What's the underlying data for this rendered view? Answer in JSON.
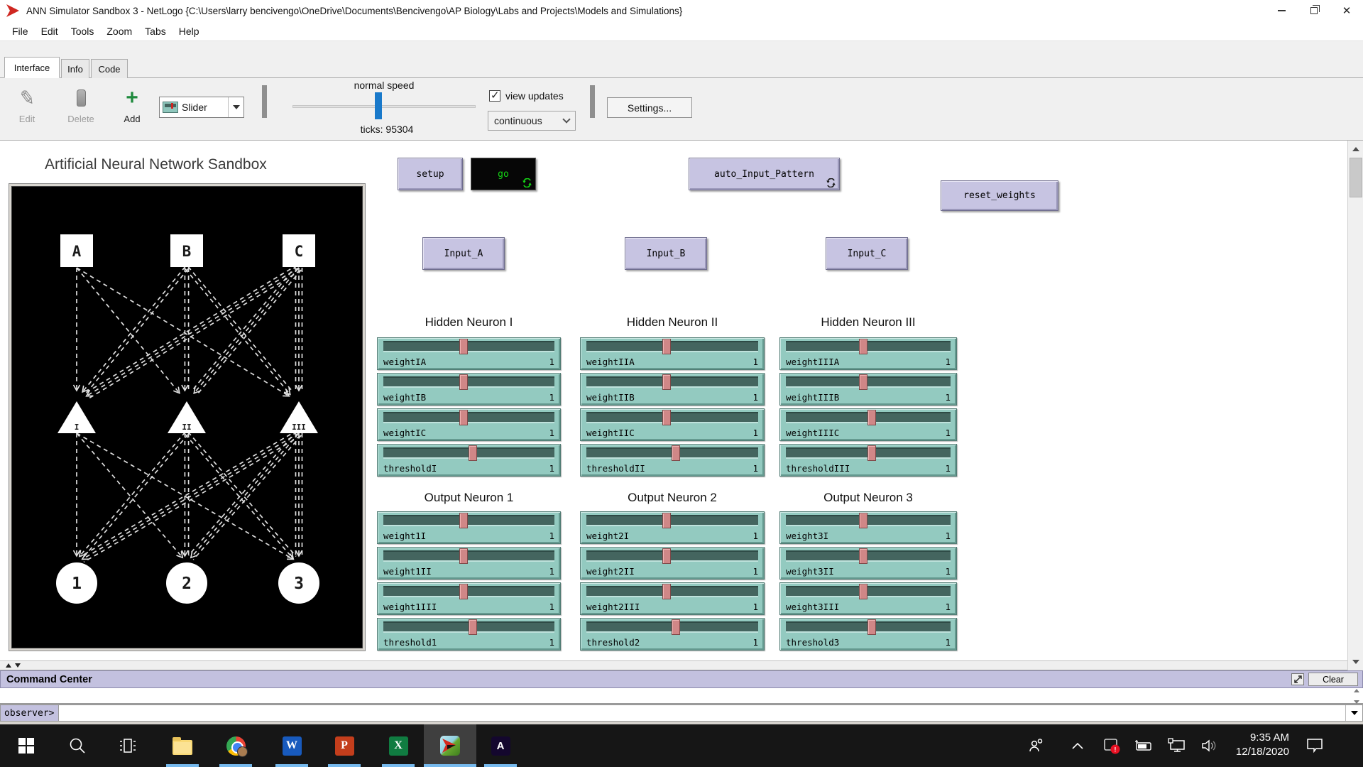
{
  "window": {
    "title": "ANN Simulator Sandbox 3 - NetLogo {C:\\Users\\larry bencivengo\\OneDrive\\Documents\\Bencivengo\\AP Biology\\Labs and Projects\\Models and Simulations}"
  },
  "menu_bar": {
    "items": [
      "File",
      "Edit",
      "Tools",
      "Zoom",
      "Tabs",
      "Help"
    ]
  },
  "tab_bar": {
    "tabs": [
      {
        "label": "Interface",
        "active": true
      },
      {
        "label": "Info",
        "active": false
      },
      {
        "label": "Code",
        "active": false
      }
    ]
  },
  "toolbar": {
    "edit_label": "Edit",
    "delete_label": "Delete",
    "add_label": "Add",
    "widget_chooser_value": "Slider",
    "speed_label": "normal speed",
    "ticks_label": "ticks: 95304",
    "view_updates_label": "view updates",
    "view_updates_checked": true,
    "update_mode_value": "continuous",
    "settings_label": "Settings..."
  },
  "workspace": {
    "title": "Artificial Neural Network Sandbox",
    "buttons": {
      "setup": "setup",
      "go": "go",
      "auto_input_pattern": "auto_Input_Pattern",
      "reset_weights": "reset_weights",
      "input_a": "Input_A",
      "input_b": "Input_B",
      "input_c": "Input_C"
    },
    "network": {
      "input_nodes": [
        "A",
        "B",
        "C"
      ],
      "hidden_nodes": [
        "I",
        "II",
        "III"
      ],
      "output_nodes": [
        "1",
        "2",
        "3"
      ],
      "topology": "fully-connected input-to-hidden and hidden-to-output"
    },
    "slider_groups": [
      {
        "title": "Hidden Neuron I",
        "sliders": [
          {
            "label": "weightIA",
            "value": "1",
            "pct": 47
          },
          {
            "label": "weightIB",
            "value": "1",
            "pct": 47
          },
          {
            "label": "weightIC",
            "value": "1",
            "pct": 47
          },
          {
            "label": "thresholdI",
            "value": "1",
            "pct": 52
          }
        ]
      },
      {
        "title": "Hidden Neuron II",
        "sliders": [
          {
            "label": "weightIIA",
            "value": "1",
            "pct": 47
          },
          {
            "label": "weightIIB",
            "value": "1",
            "pct": 47
          },
          {
            "label": "weightIIC",
            "value": "1",
            "pct": 47
          },
          {
            "label": "thresholdII",
            "value": "1",
            "pct": 52
          }
        ]
      },
      {
        "title": "Hidden Neuron III",
        "sliders": [
          {
            "label": "weightIIIA",
            "value": "1",
            "pct": 47
          },
          {
            "label": "weightIIIB",
            "value": "1",
            "pct": 47
          },
          {
            "label": "weightIIIC",
            "value": "1",
            "pct": 52
          },
          {
            "label": "thresholdIII",
            "value": "1",
            "pct": 52
          }
        ]
      },
      {
        "title": "Output Neuron 1",
        "sliders": [
          {
            "label": "weight1I",
            "value": "1",
            "pct": 47
          },
          {
            "label": "weight1II",
            "value": "1",
            "pct": 47
          },
          {
            "label": "weight1III",
            "value": "1",
            "pct": 47
          },
          {
            "label": "threshold1",
            "value": "1",
            "pct": 52
          }
        ]
      },
      {
        "title": "Output Neuron 2",
        "sliders": [
          {
            "label": "weight2I",
            "value": "1",
            "pct": 47
          },
          {
            "label": "weight2II",
            "value": "1",
            "pct": 47
          },
          {
            "label": "weight2III",
            "value": "1",
            "pct": 47
          },
          {
            "label": "threshold2",
            "value": "1",
            "pct": 52
          }
        ]
      },
      {
        "title": "Output Neuron 3",
        "sliders": [
          {
            "label": "weight3I",
            "value": "1",
            "pct": 47
          },
          {
            "label": "weight3II",
            "value": "1",
            "pct": 47
          },
          {
            "label": "weight3III",
            "value": "1",
            "pct": 47
          },
          {
            "label": "threshold3",
            "value": "1",
            "pct": 52
          }
        ]
      }
    ]
  },
  "command_center": {
    "title": "Command Center",
    "clear_label": "Clear",
    "prompt": "observer>",
    "input_value": ""
  },
  "taskbar": {
    "time": "9:35 AM",
    "date": "12/18/2020",
    "apps": [
      "start",
      "search",
      "task-view",
      "file-explorer",
      "chrome",
      "word",
      "powerpoint",
      "excel",
      "netlogo",
      "acrobat"
    ],
    "tray": [
      "people",
      "chevron-up",
      "security-alert",
      "battery",
      "network",
      "volume",
      "action-center"
    ]
  },
  "colors": {
    "button_lavender": "#c7c4e2",
    "slider_face": "#93cac0",
    "slider_track": "#44655f",
    "slider_handle": "#d08787",
    "go_text": "#15d615",
    "speed_handle": "#1979ca",
    "command_header": "#c3c1df",
    "taskbar": "#161616",
    "run_indicator": "#76b9ed"
  }
}
